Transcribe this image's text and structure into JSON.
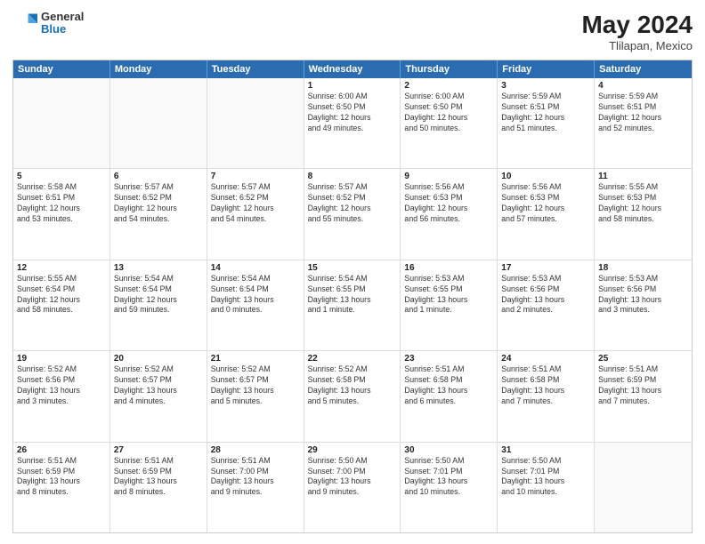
{
  "header": {
    "logo": {
      "general": "General",
      "blue": "Blue"
    },
    "title": "May 2024",
    "location": "Tlilapan, Mexico"
  },
  "weekdays": [
    "Sunday",
    "Monday",
    "Tuesday",
    "Wednesday",
    "Thursday",
    "Friday",
    "Saturday"
  ],
  "rows": [
    [
      {
        "day": "",
        "text": "",
        "empty": true
      },
      {
        "day": "",
        "text": "",
        "empty": true
      },
      {
        "day": "",
        "text": "",
        "empty": true
      },
      {
        "day": "1",
        "text": "Sunrise: 6:00 AM\nSunset: 6:50 PM\nDaylight: 12 hours\nand 49 minutes.",
        "empty": false
      },
      {
        "day": "2",
        "text": "Sunrise: 6:00 AM\nSunset: 6:50 PM\nDaylight: 12 hours\nand 50 minutes.",
        "empty": false
      },
      {
        "day": "3",
        "text": "Sunrise: 5:59 AM\nSunset: 6:51 PM\nDaylight: 12 hours\nand 51 minutes.",
        "empty": false
      },
      {
        "day": "4",
        "text": "Sunrise: 5:59 AM\nSunset: 6:51 PM\nDaylight: 12 hours\nand 52 minutes.",
        "empty": false
      }
    ],
    [
      {
        "day": "5",
        "text": "Sunrise: 5:58 AM\nSunset: 6:51 PM\nDaylight: 12 hours\nand 53 minutes.",
        "empty": false
      },
      {
        "day": "6",
        "text": "Sunrise: 5:57 AM\nSunset: 6:52 PM\nDaylight: 12 hours\nand 54 minutes.",
        "empty": false
      },
      {
        "day": "7",
        "text": "Sunrise: 5:57 AM\nSunset: 6:52 PM\nDaylight: 12 hours\nand 54 minutes.",
        "empty": false
      },
      {
        "day": "8",
        "text": "Sunrise: 5:57 AM\nSunset: 6:52 PM\nDaylight: 12 hours\nand 55 minutes.",
        "empty": false
      },
      {
        "day": "9",
        "text": "Sunrise: 5:56 AM\nSunset: 6:53 PM\nDaylight: 12 hours\nand 56 minutes.",
        "empty": false
      },
      {
        "day": "10",
        "text": "Sunrise: 5:56 AM\nSunset: 6:53 PM\nDaylight: 12 hours\nand 57 minutes.",
        "empty": false
      },
      {
        "day": "11",
        "text": "Sunrise: 5:55 AM\nSunset: 6:53 PM\nDaylight: 12 hours\nand 58 minutes.",
        "empty": false
      }
    ],
    [
      {
        "day": "12",
        "text": "Sunrise: 5:55 AM\nSunset: 6:54 PM\nDaylight: 12 hours\nand 58 minutes.",
        "empty": false
      },
      {
        "day": "13",
        "text": "Sunrise: 5:54 AM\nSunset: 6:54 PM\nDaylight: 12 hours\nand 59 minutes.",
        "empty": false
      },
      {
        "day": "14",
        "text": "Sunrise: 5:54 AM\nSunset: 6:54 PM\nDaylight: 13 hours\nand 0 minutes.",
        "empty": false
      },
      {
        "day": "15",
        "text": "Sunrise: 5:54 AM\nSunset: 6:55 PM\nDaylight: 13 hours\nand 1 minute.",
        "empty": false
      },
      {
        "day": "16",
        "text": "Sunrise: 5:53 AM\nSunset: 6:55 PM\nDaylight: 13 hours\nand 1 minute.",
        "empty": false
      },
      {
        "day": "17",
        "text": "Sunrise: 5:53 AM\nSunset: 6:56 PM\nDaylight: 13 hours\nand 2 minutes.",
        "empty": false
      },
      {
        "day": "18",
        "text": "Sunrise: 5:53 AM\nSunset: 6:56 PM\nDaylight: 13 hours\nand 3 minutes.",
        "empty": false
      }
    ],
    [
      {
        "day": "19",
        "text": "Sunrise: 5:52 AM\nSunset: 6:56 PM\nDaylight: 13 hours\nand 3 minutes.",
        "empty": false
      },
      {
        "day": "20",
        "text": "Sunrise: 5:52 AM\nSunset: 6:57 PM\nDaylight: 13 hours\nand 4 minutes.",
        "empty": false
      },
      {
        "day": "21",
        "text": "Sunrise: 5:52 AM\nSunset: 6:57 PM\nDaylight: 13 hours\nand 5 minutes.",
        "empty": false
      },
      {
        "day": "22",
        "text": "Sunrise: 5:52 AM\nSunset: 6:58 PM\nDaylight: 13 hours\nand 5 minutes.",
        "empty": false
      },
      {
        "day": "23",
        "text": "Sunrise: 5:51 AM\nSunset: 6:58 PM\nDaylight: 13 hours\nand 6 minutes.",
        "empty": false
      },
      {
        "day": "24",
        "text": "Sunrise: 5:51 AM\nSunset: 6:58 PM\nDaylight: 13 hours\nand 7 minutes.",
        "empty": false
      },
      {
        "day": "25",
        "text": "Sunrise: 5:51 AM\nSunset: 6:59 PM\nDaylight: 13 hours\nand 7 minutes.",
        "empty": false
      }
    ],
    [
      {
        "day": "26",
        "text": "Sunrise: 5:51 AM\nSunset: 6:59 PM\nDaylight: 13 hours\nand 8 minutes.",
        "empty": false
      },
      {
        "day": "27",
        "text": "Sunrise: 5:51 AM\nSunset: 6:59 PM\nDaylight: 13 hours\nand 8 minutes.",
        "empty": false
      },
      {
        "day": "28",
        "text": "Sunrise: 5:51 AM\nSunset: 7:00 PM\nDaylight: 13 hours\nand 9 minutes.",
        "empty": false
      },
      {
        "day": "29",
        "text": "Sunrise: 5:50 AM\nSunset: 7:00 PM\nDaylight: 13 hours\nand 9 minutes.",
        "empty": false
      },
      {
        "day": "30",
        "text": "Sunrise: 5:50 AM\nSunset: 7:01 PM\nDaylight: 13 hours\nand 10 minutes.",
        "empty": false
      },
      {
        "day": "31",
        "text": "Sunrise: 5:50 AM\nSunset: 7:01 PM\nDaylight: 13 hours\nand 10 minutes.",
        "empty": false
      },
      {
        "day": "",
        "text": "",
        "empty": true
      }
    ]
  ]
}
